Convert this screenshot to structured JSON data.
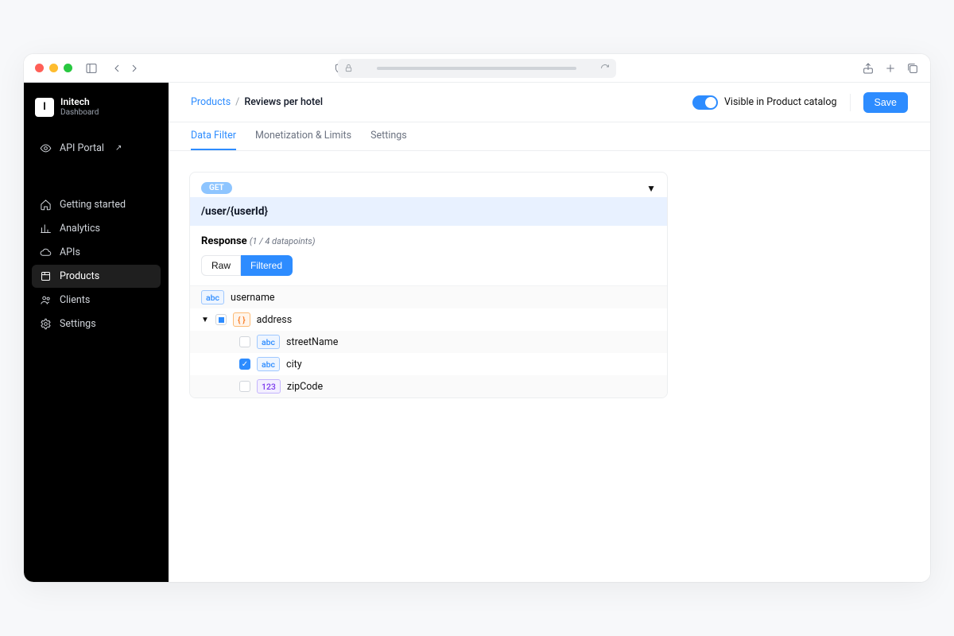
{
  "org": {
    "logo_letter": "I",
    "name": "Initech",
    "subtitle": "Dashboard"
  },
  "sidebar": {
    "portal": "API Portal",
    "items": [
      {
        "label": "Getting started"
      },
      {
        "label": "Analytics"
      },
      {
        "label": "APIs"
      },
      {
        "label": "Products"
      },
      {
        "label": "Clients"
      },
      {
        "label": "Settings"
      }
    ]
  },
  "breadcrumb": {
    "root": "Products",
    "current": "Reviews per hotel"
  },
  "topbar": {
    "toggle_label": "Visible in Product catalog",
    "save": "Save"
  },
  "tabs": [
    "Data Filter",
    "Monetization & Limits",
    "Settings"
  ],
  "method": "GET",
  "path": "/user/{userId}",
  "response": {
    "title": "Response",
    "meta": "(1 / 4 datapoints)"
  },
  "segmented": {
    "raw": "Raw",
    "filtered": "Filtered"
  },
  "type_labels": {
    "abc": "abc",
    "obj": "{ }",
    "num": "123"
  },
  "fields": {
    "username": "username",
    "address": "address",
    "streetName": "streetName",
    "city": "city",
    "zipCode": "zipCode"
  }
}
